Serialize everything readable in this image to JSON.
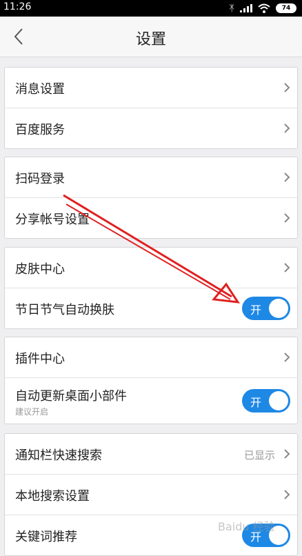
{
  "status": {
    "time": "11:26",
    "battery": "74"
  },
  "header": {
    "title": "设置"
  },
  "groups": [
    {
      "rows": [
        {
          "label": "消息设置"
        },
        {
          "label": "百度服务"
        }
      ]
    },
    {
      "rows": [
        {
          "label": "扫码登录"
        },
        {
          "label": "分享帐号设置"
        }
      ]
    },
    {
      "rows": [
        {
          "label": "皮肤中心"
        },
        {
          "label": "节日节气自动换肤",
          "toggle": "开",
          "toggle_on": true
        }
      ]
    },
    {
      "rows": [
        {
          "label": "插件中心"
        },
        {
          "label": "自动更新桌面小部件",
          "sublabel": "建议开启",
          "toggle": "开",
          "toggle_on": true
        }
      ]
    },
    {
      "rows": [
        {
          "label": "通知栏快速搜索",
          "value": "已显示"
        },
        {
          "label": "本地搜索设置"
        },
        {
          "label": "关键词推荐",
          "toggle": "开",
          "toggle_on": true
        }
      ]
    }
  ],
  "colors": {
    "accent": "#1e88e5",
    "annotation": "#e02020"
  },
  "watermark": "Baidu 经验"
}
